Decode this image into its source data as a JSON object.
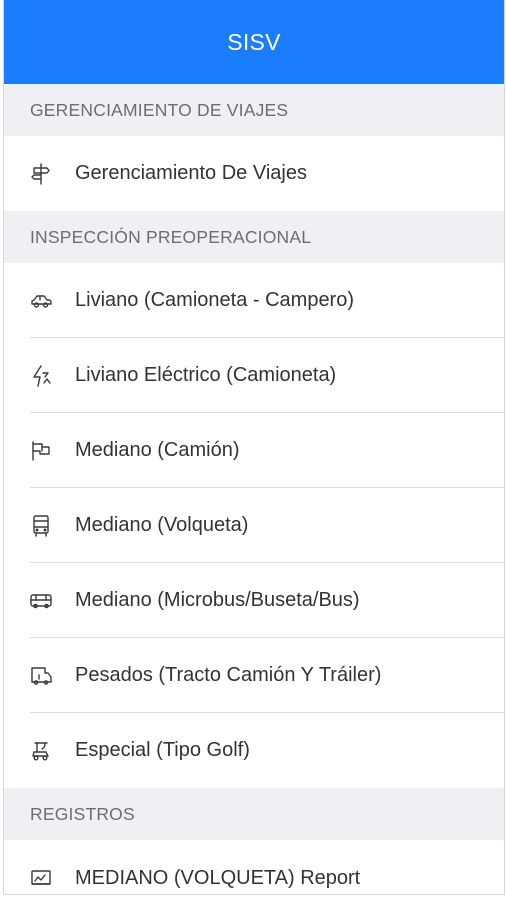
{
  "colors": {
    "header_bg": "#1a7dfb",
    "header_text": "#ffffff",
    "section_bg": "#efeff4"
  },
  "header": {
    "title": "SISV"
  },
  "sections": [
    {
      "title": "GERENCIAMIENTO DE VIAJES",
      "items": [
        {
          "label": "Gerenciamiento De Viajes",
          "icon": "signpost-icon"
        }
      ]
    },
    {
      "title": "INSPECCIÓN PREOPERACIONAL",
      "items": [
        {
          "label": "Liviano (Camioneta - Campero)",
          "icon": "car-icon"
        },
        {
          "label": "Liviano Eléctrico (Camioneta)",
          "icon": "flash-icon"
        },
        {
          "label": "Mediano (Camión)",
          "icon": "flag-icon"
        },
        {
          "label": "Mediano (Volqueta)",
          "icon": "truck-front-icon"
        },
        {
          "label": "Mediano (Microbus/Buseta/Bus)",
          "icon": "bus-icon"
        },
        {
          "label": "Pesados (Tracto Camión Y Tráiler)",
          "icon": "trailer-icon"
        },
        {
          "label": "Especial (Tipo Golf)",
          "icon": "golf-cart-icon"
        }
      ]
    },
    {
      "title": "REGISTROS",
      "items": [
        {
          "label": "MEDIANO (VOLQUETA) Report",
          "icon": "report-icon"
        }
      ]
    }
  ]
}
